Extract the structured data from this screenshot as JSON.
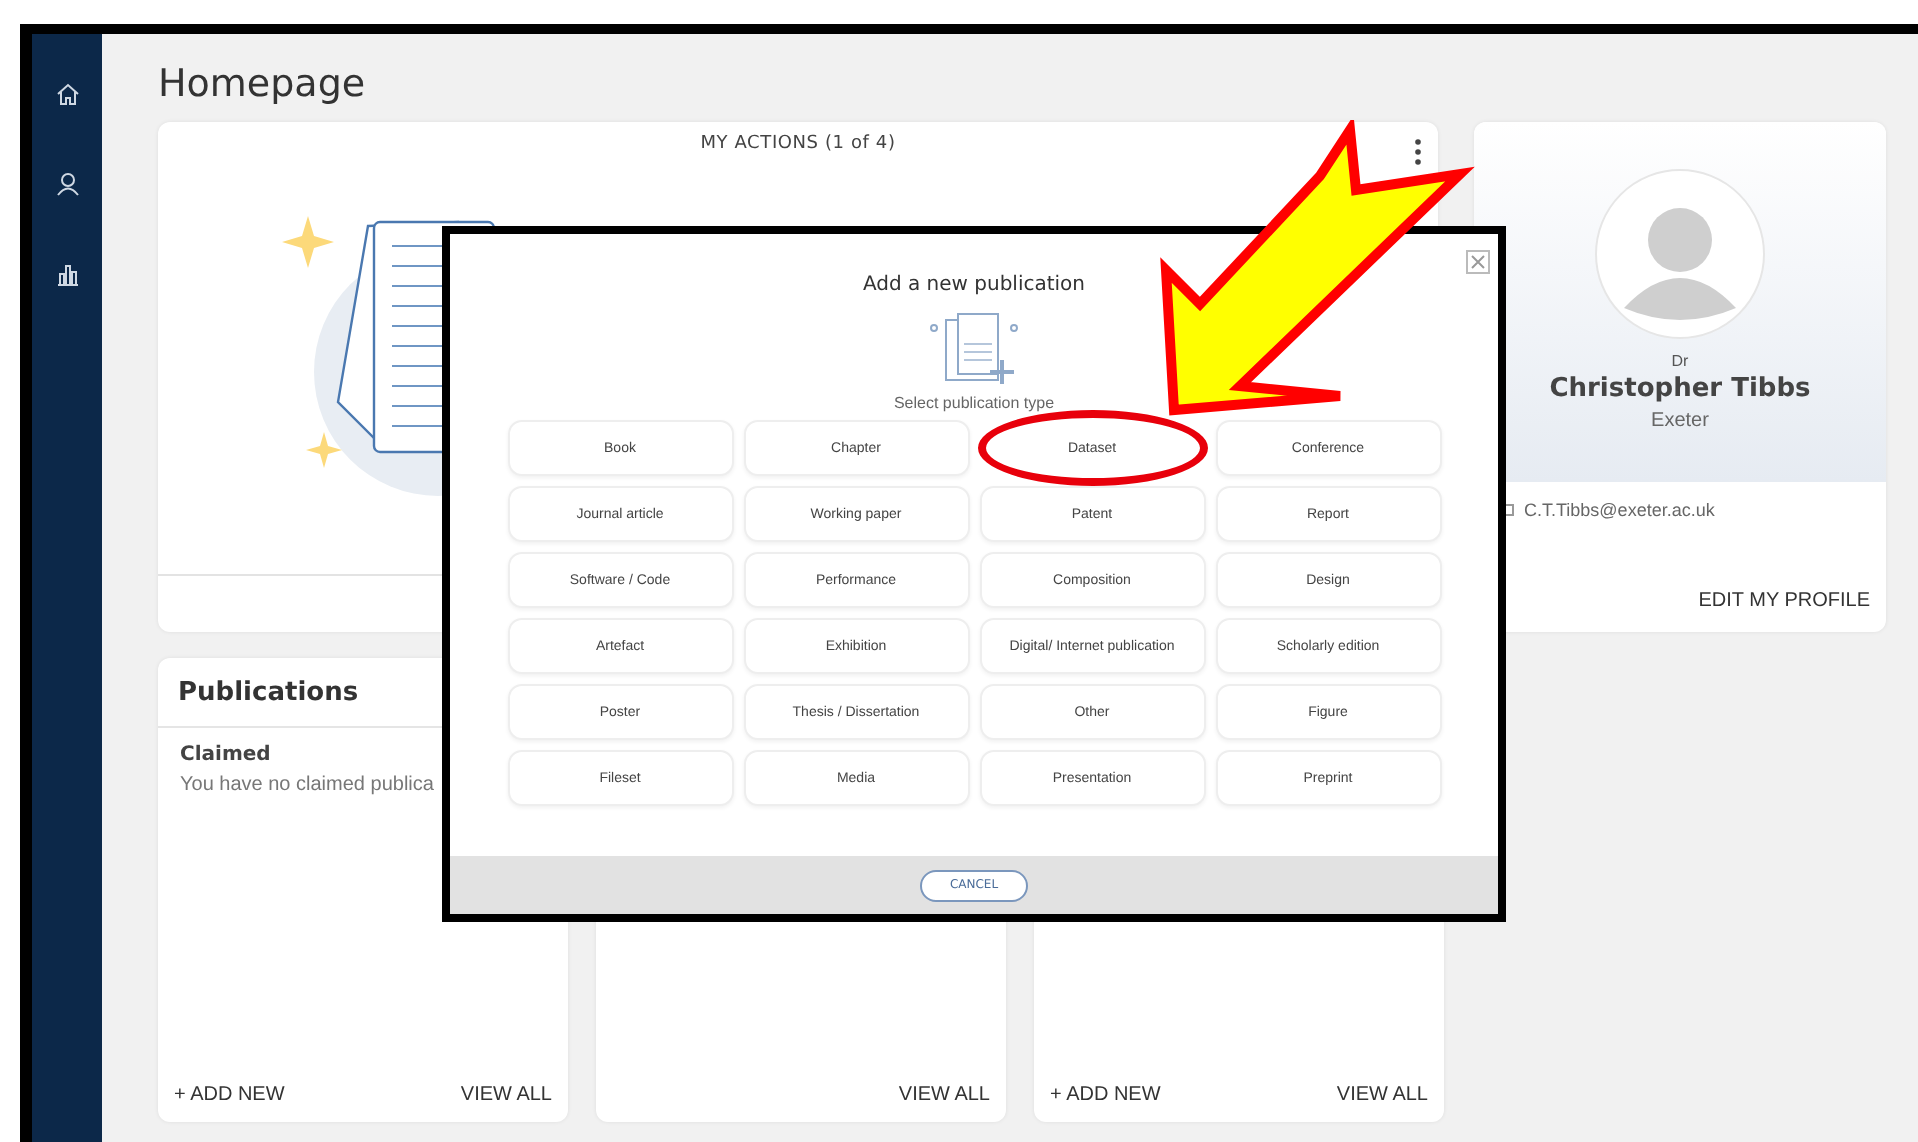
{
  "page": {
    "title": "Homepage"
  },
  "sidebar": {
    "items": [
      {
        "kind": "home"
      },
      {
        "kind": "person"
      },
      {
        "kind": "chart"
      }
    ]
  },
  "actions_card": {
    "title": "MY ACTIONS (1 of 4)"
  },
  "profile": {
    "honorific": "Dr",
    "name": "Christopher Tibbs",
    "institution": "Exeter",
    "email": "C.T.Tibbs@exeter.ac.uk",
    "edit_link": "EDIT MY PROFILE"
  },
  "cards": [
    {
      "title": "Publications",
      "section": "Claimed",
      "message": "You have no claimed publica",
      "add_link": "+ ADD NEW",
      "view_link": "VIEW ALL"
    },
    {
      "view_link": "VIEW ALL"
    },
    {
      "add_link": "+ ADD NEW",
      "view_link": "VIEW ALL"
    }
  ],
  "modal": {
    "title": "Add a new publication",
    "subtitle": "Select publication type",
    "cancel": "CANCEL",
    "types": [
      {
        "label": "Book",
        "circled": false
      },
      {
        "label": "Chapter",
        "circled": false
      },
      {
        "label": "Dataset",
        "circled": true
      },
      {
        "label": "Conference",
        "circled": false
      },
      {
        "label": "Journal article",
        "circled": false
      },
      {
        "label": "Working paper",
        "circled": false
      },
      {
        "label": "Patent",
        "circled": false
      },
      {
        "label": "Report",
        "circled": false
      },
      {
        "label": "Software / Code",
        "circled": false
      },
      {
        "label": "Performance",
        "circled": false
      },
      {
        "label": "Composition",
        "circled": false
      },
      {
        "label": "Design",
        "circled": false
      },
      {
        "label": "Artefact",
        "circled": false
      },
      {
        "label": "Exhibition",
        "circled": false
      },
      {
        "label": "Digital/ Internet publication",
        "circled": false
      },
      {
        "label": "Scholarly edition",
        "circled": false
      },
      {
        "label": "Poster",
        "circled": false
      },
      {
        "label": "Thesis / Dissertation",
        "circled": false
      },
      {
        "label": "Other",
        "circled": false
      },
      {
        "label": "Figure",
        "circled": false
      },
      {
        "label": "Fileset",
        "circled": false
      },
      {
        "label": "Media",
        "circled": false
      },
      {
        "label": "Presentation",
        "circled": false
      },
      {
        "label": "Preprint",
        "circled": false
      }
    ]
  }
}
